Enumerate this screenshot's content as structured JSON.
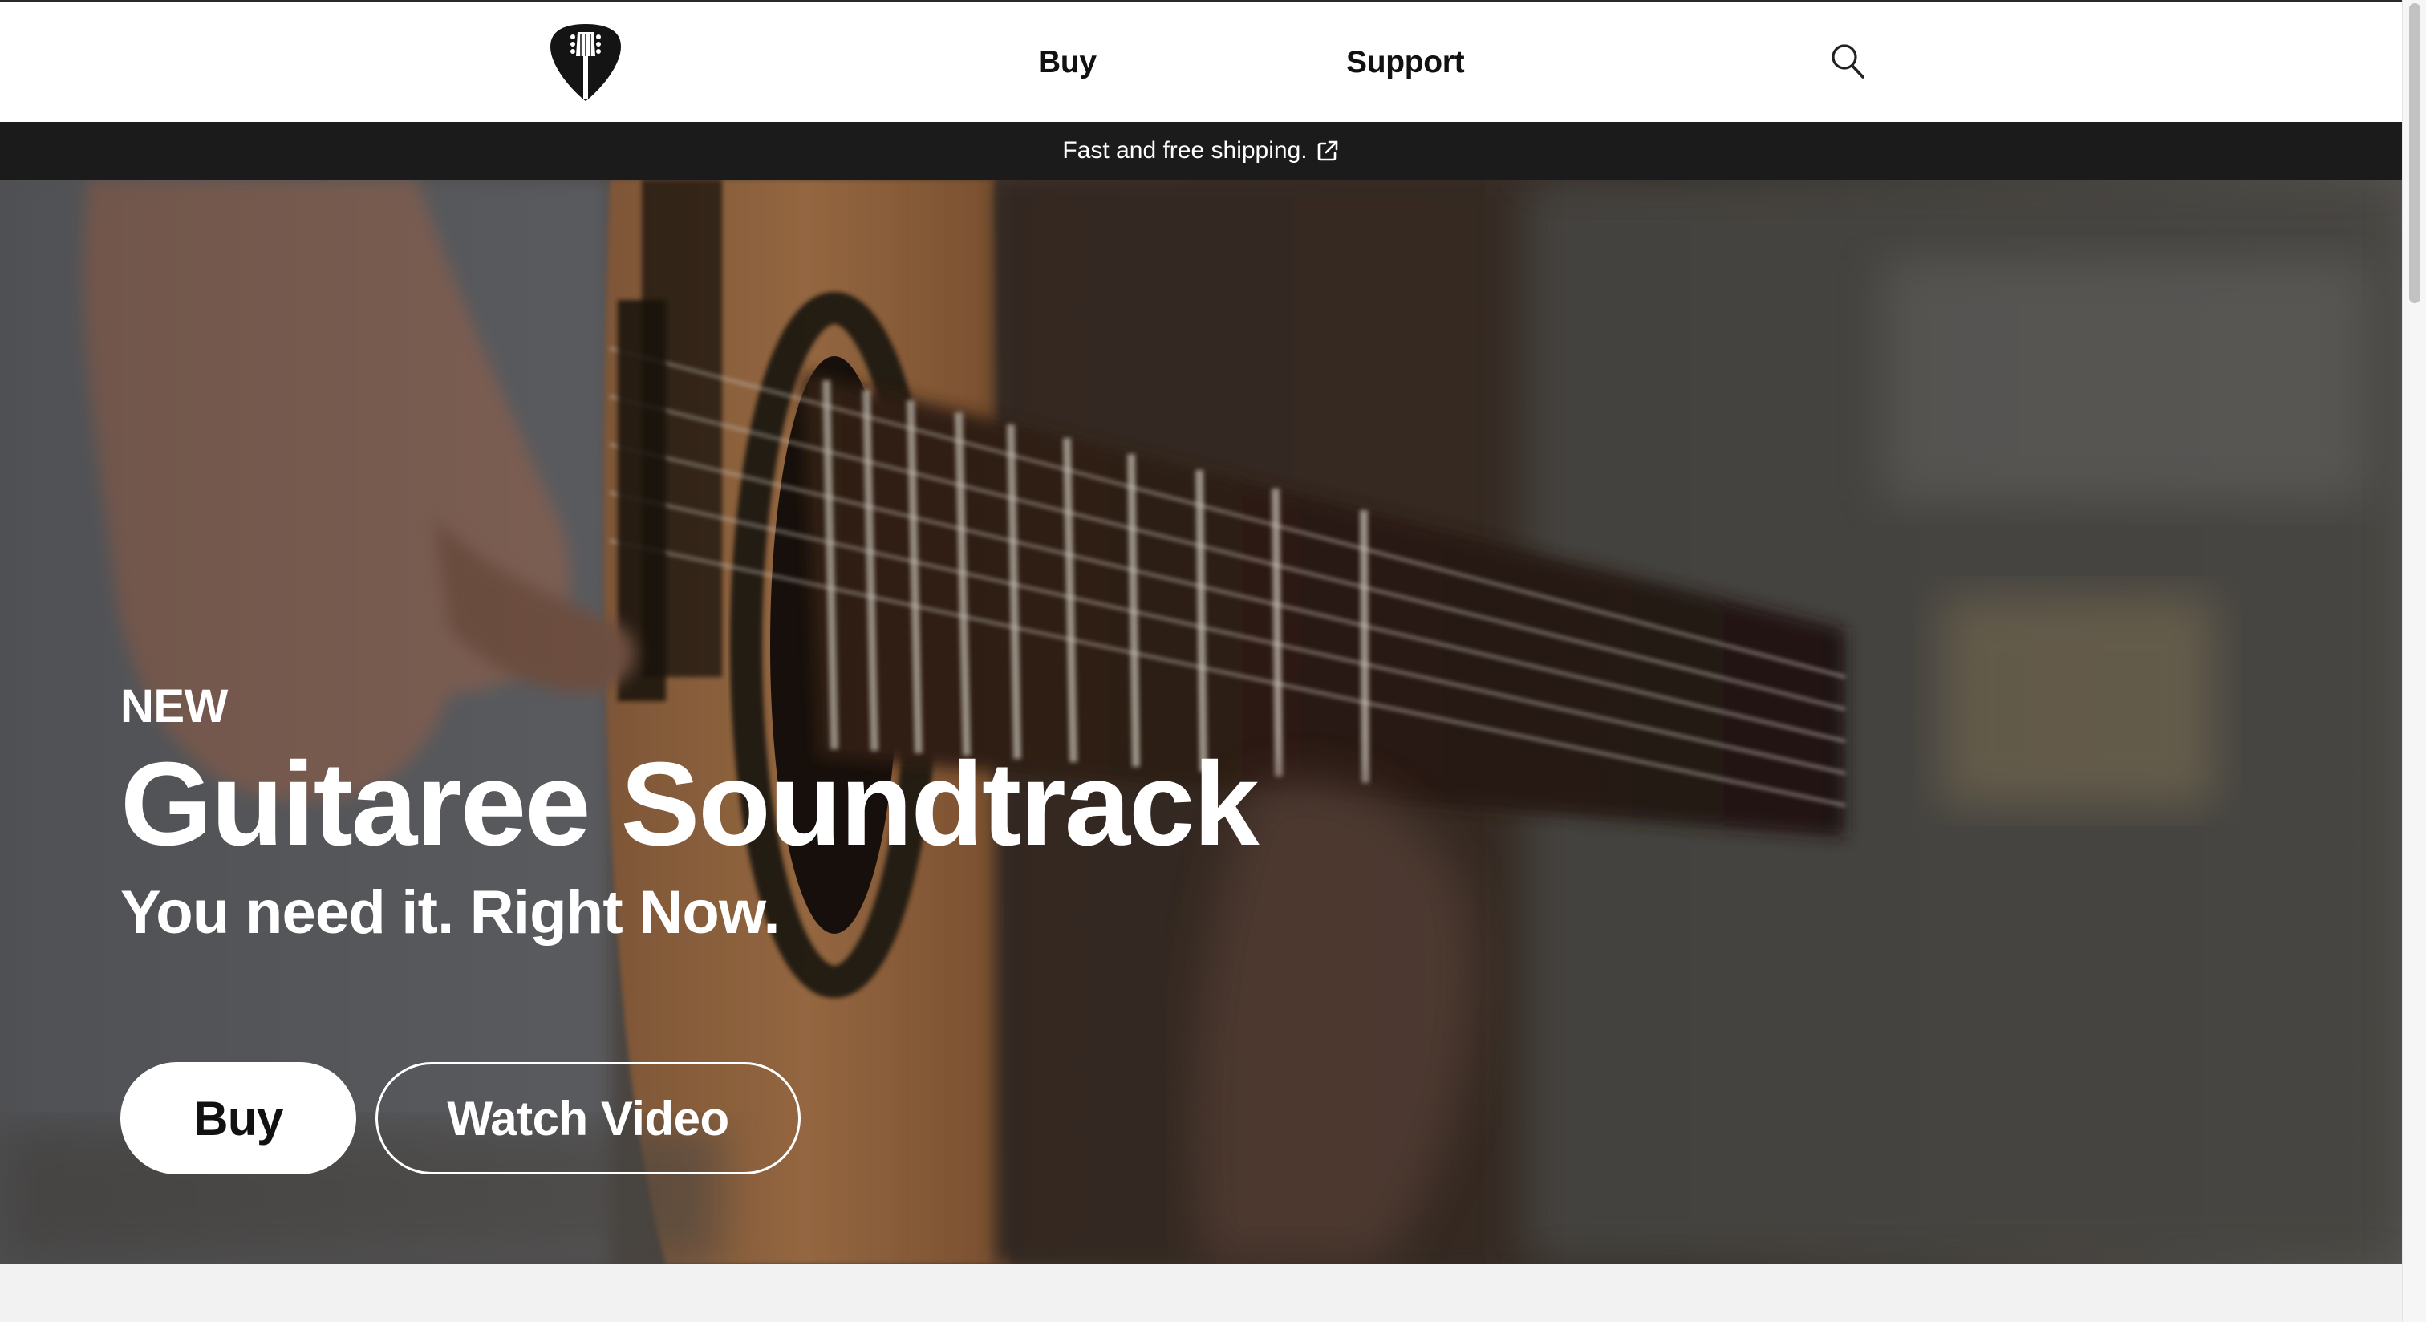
{
  "header": {
    "logo_icon": "guitar-pick-logo-icon",
    "nav": [
      {
        "label": "Buy"
      },
      {
        "label": "Support"
      }
    ],
    "search_icon": "search-icon"
  },
  "announcement": {
    "text": "Fast and free shipping.",
    "icon": "external-link-icon"
  },
  "hero": {
    "eyebrow": "NEW",
    "title": "Guitaree Soundtrack",
    "subtitle": "You need it. Right Now.",
    "buttons": {
      "primary_label": "Buy",
      "secondary_label": "Watch Video"
    },
    "background_image": "blurred close-up of hand strumming acoustic guitar"
  },
  "colors": {
    "header_bg": "#ffffff",
    "announcement_bg": "#1b1b1b",
    "text_dark": "#111111",
    "text_light": "#ffffff",
    "footer_strip_bg": "#f2f2f3"
  }
}
